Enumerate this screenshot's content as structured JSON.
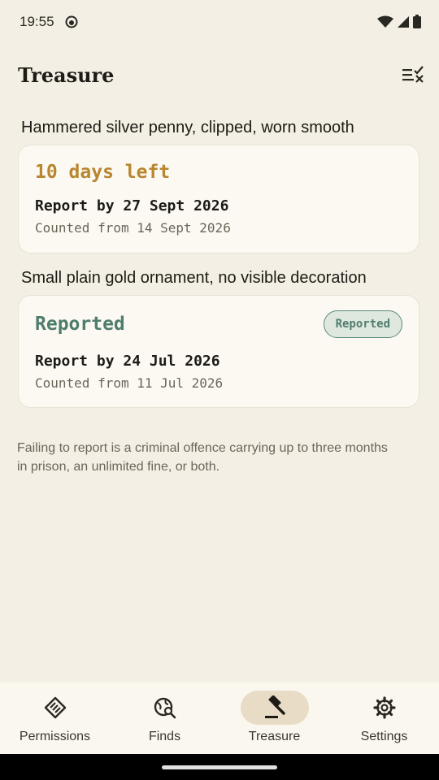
{
  "status_bar": {
    "time": "19:55"
  },
  "app_bar": {
    "title": "Treasure"
  },
  "finds": [
    {
      "heading": "Hammered silver penny, clipped, worn smooth",
      "status": "10 days left",
      "status_color": "#b8862e",
      "report_by": "Report by 27 Sept 2026",
      "counted_from": "Counted from 14 Sept 2026"
    },
    {
      "heading": "Small plain gold ornament, no visible decoration",
      "status": "Reported",
      "status_color": "#4f7d6d",
      "chip": "Reported",
      "report_by": "Report by 24 Jul 2026",
      "counted_from": "Counted from 11 Jul 2026"
    }
  ],
  "footnote": "Failing to report is a criminal offence carrying up to three months in prison, an unlimited fine, or both.",
  "nav": {
    "items": [
      {
        "label": "Permissions",
        "icon": "handshake-icon"
      },
      {
        "label": "Finds",
        "icon": "globe-search-icon"
      },
      {
        "label": "Treasure",
        "icon": "gavel-icon",
        "active": true
      },
      {
        "label": "Settings",
        "icon": "gear-icon"
      }
    ]
  }
}
